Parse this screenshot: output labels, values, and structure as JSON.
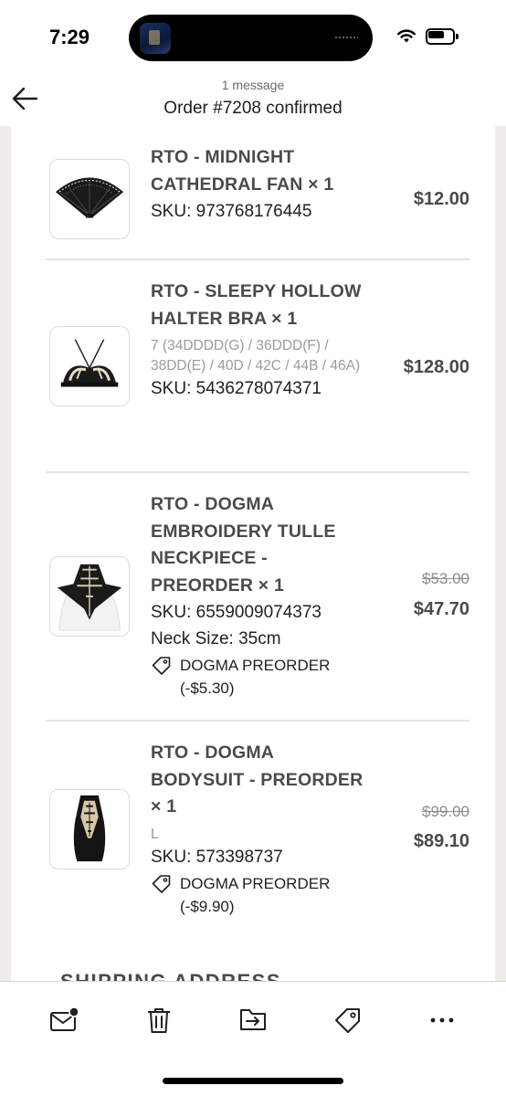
{
  "status_bar": {
    "time": "7:29",
    "wifi_icon": "wifi-icon",
    "battery_level": 0.65
  },
  "header": {
    "subtitle": "1 message",
    "title": "Order #7208 confirmed",
    "back_icon": "arrow-left-icon"
  },
  "order": {
    "items": [
      {
        "name": "RTO - MIDNIGHT CATHEDRAL FAN × 1",
        "variant": "",
        "sku": "SKU: 973768176445",
        "extra": "",
        "discount": "",
        "price_old": "",
        "price": "$12.00",
        "thumb_icon": "lace-fan-image"
      },
      {
        "name": "RTO - SLEEPY HOLLOW HALTER BRA × 1",
        "variant": "7 (34DDDD(G) / 36DDD(F) / 38DD(E) / 40D / 42C / 44B / 46A)",
        "sku": "SKU: 5436278074371",
        "extra": "",
        "discount": "",
        "price_old": "",
        "price": "$128.00",
        "thumb_icon": "halter-bra-image"
      },
      {
        "name": "RTO - DOGMA EMBROIDERY TULLE NECKPIECE - PREORDER × 1",
        "variant": "",
        "sku": "SKU: 6559009074373",
        "extra": "Neck Size: 35cm",
        "discount": "DOGMA PREORDER (-$5.30)",
        "price_old": "$53.00",
        "price": "$47.70",
        "thumb_icon": "neckpiece-image"
      },
      {
        "name": "RTO - DOGMA BODYSUIT - PREORDER × 1",
        "variant": "L",
        "sku": "SKU: 573398737",
        "extra": "",
        "discount": "DOGMA PREORDER (-$9.90)",
        "price_old": "$99.00",
        "price": "$89.10",
        "thumb_icon": "bodysuit-image"
      }
    ],
    "next_section_heading": "SHIPPING ADDRESS"
  },
  "toolbar": {
    "buttons": [
      {
        "name": "mark-unread",
        "icon": "envelope-badge-icon"
      },
      {
        "name": "delete",
        "icon": "trash-icon"
      },
      {
        "name": "move",
        "icon": "move-to-folder-icon"
      },
      {
        "name": "label",
        "icon": "tag-icon"
      },
      {
        "name": "more",
        "icon": "ellipsis-icon"
      }
    ]
  },
  "colors": {
    "email_background": "#efedea",
    "card_background": "#ffffff",
    "product_text": "#4a4a4a",
    "muted_text": "#9b9b9b"
  }
}
